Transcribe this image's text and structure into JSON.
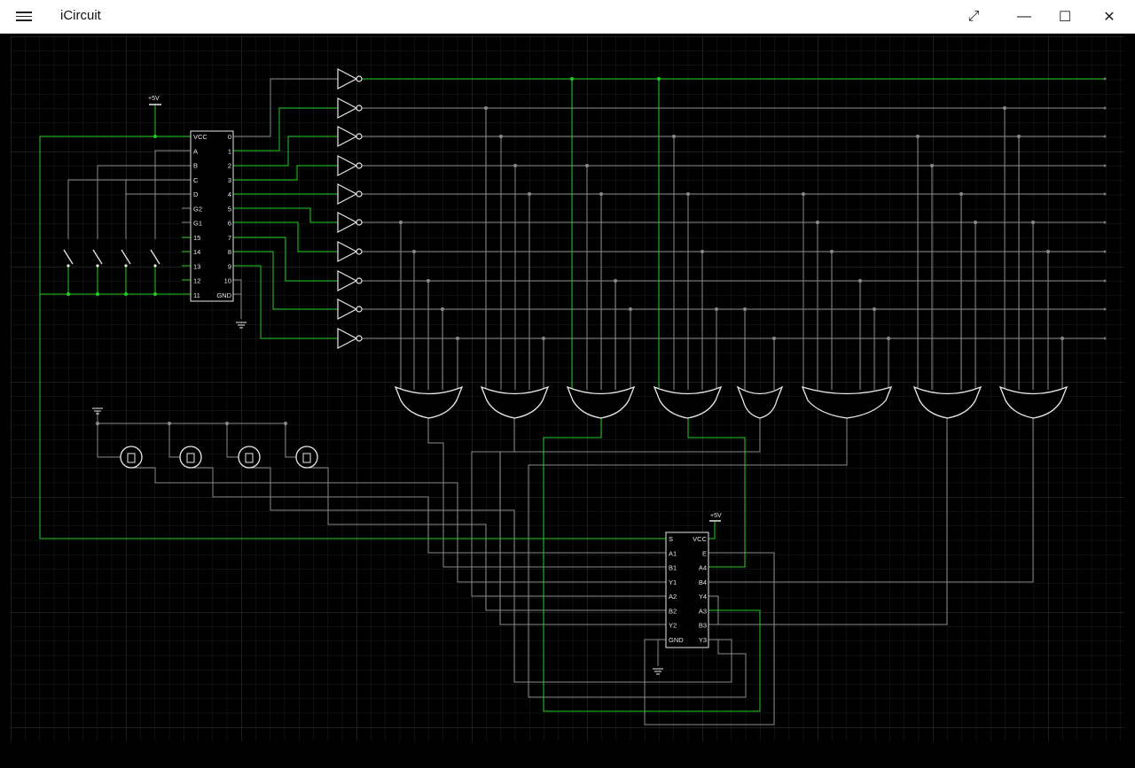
{
  "window": {
    "title": "iCircuit",
    "menu_icon": "hamburger-icon",
    "buttons": [
      "expand-icon",
      "minimize-icon",
      "maximize-icon",
      "close-icon"
    ]
  },
  "colors": {
    "background": "#000000",
    "grid": "#2a2a2a",
    "wire_idle": "#8a8a8a",
    "wire_active": "#22cc22",
    "component": "#e8e8e8"
  },
  "decoder": {
    "left_pins": [
      "VCC",
      "A",
      "B",
      "C",
      "D",
      "G2",
      "G1",
      "15",
      "14",
      "13",
      "12",
      "11"
    ],
    "right_pins": [
      "0",
      "1",
      "2",
      "3",
      "4",
      "5",
      "6",
      "7",
      "8",
      "9",
      "10",
      "GND"
    ]
  },
  "mux": {
    "left_pins": [
      "S",
      "A1",
      "B1",
      "Y1",
      "A2",
      "B2",
      "Y2",
      "GND"
    ],
    "right_pins": [
      "VCC",
      "E",
      "A4",
      "B4",
      "Y4",
      "A3",
      "B3",
      "Y3"
    ]
  },
  "supply_labels": {
    "decoder": "+5V",
    "mux": "+5V"
  }
}
